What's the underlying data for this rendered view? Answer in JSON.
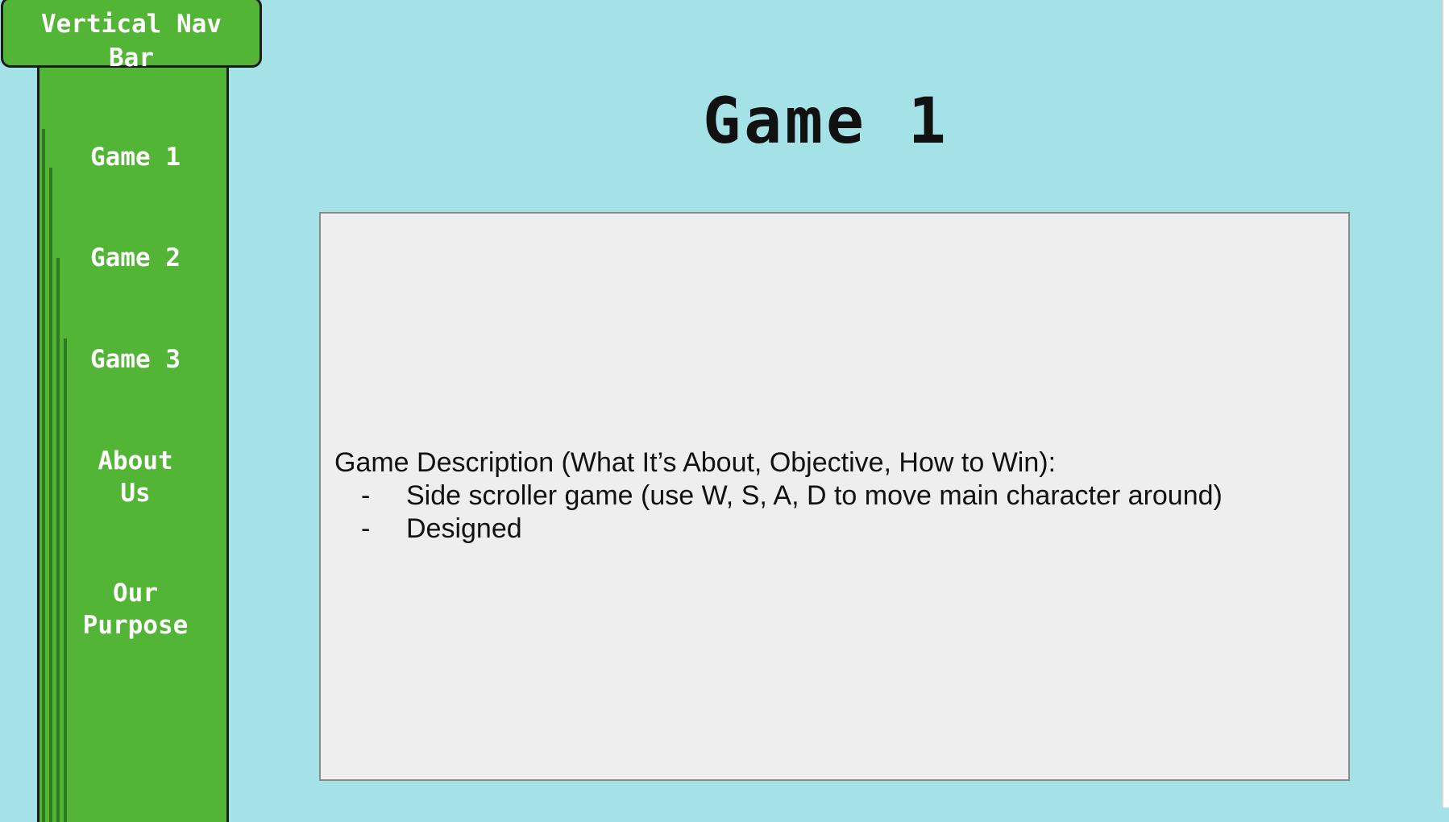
{
  "nav": {
    "title": "Vertical Nav\nBar",
    "items": [
      {
        "label": "Game 1"
      },
      {
        "label": "Game 2"
      },
      {
        "label": "Game 3"
      },
      {
        "label": "About\nUs"
      },
      {
        "label": "Our\nPurpose"
      }
    ]
  },
  "main": {
    "title": "Game 1",
    "description": {
      "heading": "Game Description (What It’s About, Objective, How to Win):",
      "bullets": [
        "Side scroller game (use W, S, A, D to move main character around)",
        "Designed"
      ],
      "bullet_marker": "-"
    }
  },
  "colors": {
    "background": "#a5e2e8",
    "nav_green": "#53b535",
    "panel": "#eeeeee"
  }
}
